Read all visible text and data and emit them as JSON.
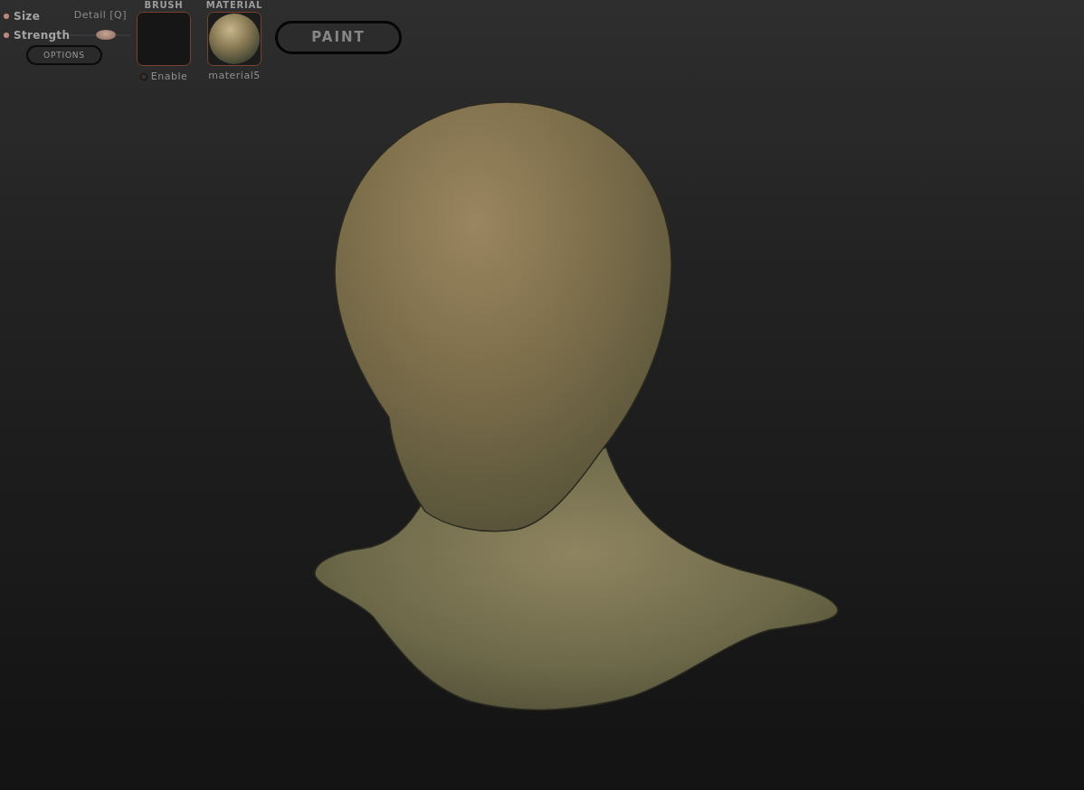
{
  "toolbar": {
    "sliders": [
      {
        "label": "Size"
      },
      {
        "label": "Strength"
      }
    ],
    "detail": {
      "label": "Detail [Q]",
      "level": 0.6
    },
    "options_button": "OPTIONS",
    "brush": {
      "title": "BRUSH",
      "enable_label": "Enable",
      "enabled": false
    },
    "material": {
      "title": "MATERIAL",
      "name": "material5"
    },
    "paint_button": "PAINT"
  }
}
